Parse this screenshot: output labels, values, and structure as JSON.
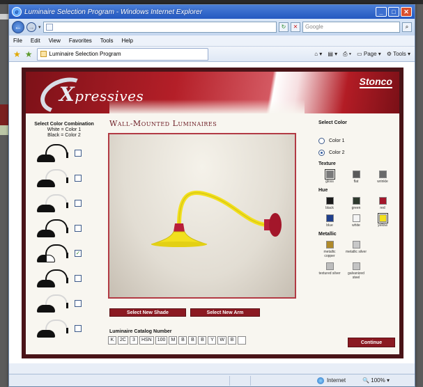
{
  "browser": {
    "title": "Luminaire Selection Program - Windows Internet Explorer",
    "url": "",
    "search_placeholder": "Google",
    "menu": [
      "File",
      "Edit",
      "View",
      "Favorites",
      "Tools",
      "Help"
    ],
    "tab_label": "Luminaire Selection Program",
    "page_label": "Page",
    "tools_label": "Tools",
    "status_zone": "Internet",
    "zoom": "100%"
  },
  "app": {
    "logo_big": "X",
    "logo_rest": "pressives",
    "brand": "Stonco",
    "heading": "Wall-Mounted Luminaires",
    "left_title": "Select Color Combination",
    "left_sub_1": "White = Color 1",
    "left_sub_2": "Black = Color 2",
    "shades": [
      {
        "arm": "black",
        "bell": "black",
        "checked": false
      },
      {
        "arm": "white",
        "bell": "black",
        "checked": false
      },
      {
        "arm": "white",
        "bell": "black",
        "checked": false
      },
      {
        "arm": "black",
        "bell": "black",
        "checked": false
      },
      {
        "arm": "black",
        "bell": "half",
        "checked": true
      },
      {
        "arm": "black",
        "bell": "black",
        "checked": false
      },
      {
        "arm": "white",
        "bell": "black",
        "checked": false
      },
      {
        "arm": "white",
        "bell": "black",
        "checked": false
      }
    ],
    "select_shade_label": "Select New Shade",
    "select_arm_label": "Select New Arm",
    "catalog_label": "Luminaire Catalog Number",
    "catalog_cells": [
      "K",
      "2C",
      "3",
      "HSN",
      "100",
      "M",
      "B",
      "B",
      "B",
      "Y",
      "W",
      "B",
      ""
    ],
    "continue_label": "Continue",
    "right": {
      "title": "Select Color",
      "color1": "Color 1",
      "color2": "Color 2",
      "selected_color": "Color 2",
      "texture_title": "Texture",
      "textures": [
        {
          "name": "gloss",
          "color": "#7a7a7a",
          "selected": true
        },
        {
          "name": "flat",
          "color": "#5a5a5a",
          "selected": false
        },
        {
          "name": "wrinkle",
          "color": "#6a6a6a",
          "selected": false
        }
      ],
      "hue_title": "Hue",
      "hues": [
        {
          "name": "black",
          "color": "#1a1a1a",
          "selected": false
        },
        {
          "name": "green",
          "color": "#2e3a2e",
          "selected": false
        },
        {
          "name": "red",
          "color": "#a3162a",
          "selected": false
        },
        {
          "name": "blue",
          "color": "#1f3f8c",
          "selected": false
        },
        {
          "name": "white",
          "color": "#f4f4f4",
          "selected": false
        },
        {
          "name": "yellow",
          "color": "#f2e01e",
          "selected": true
        }
      ],
      "metallic_title": "Metallic",
      "metallics": [
        {
          "name": "metallic copper",
          "color": "#b08a2a"
        },
        {
          "name": "metallic silver",
          "color": "#c8c8c8"
        },
        {
          "name": "textured silver",
          "color": "#bdbdbd"
        },
        {
          "name": "galvanized steel",
          "color": "#c4c4c4"
        }
      ]
    }
  },
  "colors": {
    "accent_red": "#8b1a22",
    "shade_yellow": "#f2e01e",
    "shade_red": "#b81e3a"
  }
}
